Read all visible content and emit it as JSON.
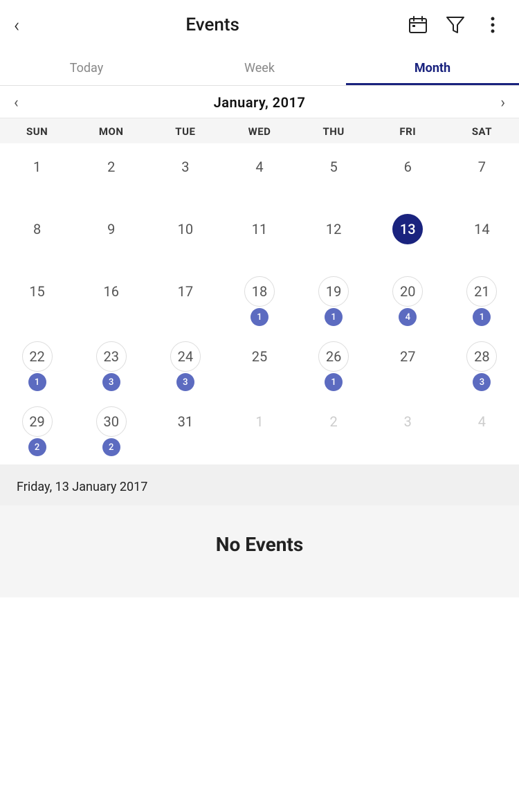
{
  "header": {
    "back_label": "‹",
    "title": "Events",
    "calendar_icon": "calendar-icon",
    "filter_icon": "filter-icon",
    "more_icon": "more-icon"
  },
  "tabs": [
    {
      "id": "today",
      "label": "Today",
      "active": false
    },
    {
      "id": "week",
      "label": "Week",
      "active": false
    },
    {
      "id": "month",
      "label": "Month",
      "active": true
    }
  ],
  "month_nav": {
    "title": "January, 2017",
    "prev_arrow": "‹",
    "next_arrow": "›"
  },
  "day_headers": [
    "SUN",
    "MON",
    "TUE",
    "WED",
    "THU",
    "FRI",
    "SAT"
  ],
  "weeks": [
    [
      {
        "day": 1,
        "otherMonth": false,
        "today": false,
        "hasRing": false,
        "events": 0
      },
      {
        "day": 2,
        "otherMonth": false,
        "today": false,
        "hasRing": false,
        "events": 0
      },
      {
        "day": 3,
        "otherMonth": false,
        "today": false,
        "hasRing": false,
        "events": 0
      },
      {
        "day": 4,
        "otherMonth": false,
        "today": false,
        "hasRing": false,
        "events": 0
      },
      {
        "day": 5,
        "otherMonth": false,
        "today": false,
        "hasRing": false,
        "events": 0
      },
      {
        "day": 6,
        "otherMonth": false,
        "today": false,
        "hasRing": false,
        "events": 0
      },
      {
        "day": 7,
        "otherMonth": false,
        "today": false,
        "hasRing": false,
        "events": 0
      }
    ],
    [
      {
        "day": 8,
        "otherMonth": false,
        "today": false,
        "hasRing": false,
        "events": 0
      },
      {
        "day": 9,
        "otherMonth": false,
        "today": false,
        "hasRing": false,
        "events": 0
      },
      {
        "day": 10,
        "otherMonth": false,
        "today": false,
        "hasRing": false,
        "events": 0
      },
      {
        "day": 11,
        "otherMonth": false,
        "today": false,
        "hasRing": false,
        "events": 0
      },
      {
        "day": 12,
        "otherMonth": false,
        "today": false,
        "hasRing": false,
        "events": 0
      },
      {
        "day": 13,
        "otherMonth": false,
        "today": true,
        "hasRing": false,
        "events": 0
      },
      {
        "day": 14,
        "otherMonth": false,
        "today": false,
        "hasRing": false,
        "events": 0
      }
    ],
    [
      {
        "day": 15,
        "otherMonth": false,
        "today": false,
        "hasRing": false,
        "events": 0
      },
      {
        "day": 16,
        "otherMonth": false,
        "today": false,
        "hasRing": false,
        "events": 0
      },
      {
        "day": 17,
        "otherMonth": false,
        "today": false,
        "hasRing": false,
        "events": 0
      },
      {
        "day": 18,
        "otherMonth": false,
        "today": false,
        "hasRing": true,
        "events": 1
      },
      {
        "day": 19,
        "otherMonth": false,
        "today": false,
        "hasRing": true,
        "events": 1
      },
      {
        "day": 20,
        "otherMonth": false,
        "today": false,
        "hasRing": true,
        "events": 4
      },
      {
        "day": 21,
        "otherMonth": false,
        "today": false,
        "hasRing": true,
        "events": 1
      }
    ],
    [
      {
        "day": 22,
        "otherMonth": false,
        "today": false,
        "hasRing": true,
        "events": 1
      },
      {
        "day": 23,
        "otherMonth": false,
        "today": false,
        "hasRing": true,
        "events": 3
      },
      {
        "day": 24,
        "otherMonth": false,
        "today": false,
        "hasRing": true,
        "events": 3
      },
      {
        "day": 25,
        "otherMonth": false,
        "today": false,
        "hasRing": false,
        "events": 0
      },
      {
        "day": 26,
        "otherMonth": false,
        "today": false,
        "hasRing": true,
        "events": 1
      },
      {
        "day": 27,
        "otherMonth": false,
        "today": false,
        "hasRing": false,
        "events": 0
      },
      {
        "day": 28,
        "otherMonth": false,
        "today": false,
        "hasRing": true,
        "events": 3
      }
    ],
    [
      {
        "day": 29,
        "otherMonth": false,
        "today": false,
        "hasRing": true,
        "events": 2
      },
      {
        "day": 30,
        "otherMonth": false,
        "today": false,
        "hasRing": true,
        "events": 2
      },
      {
        "day": 31,
        "otherMonth": false,
        "today": false,
        "hasRing": false,
        "events": 0
      },
      {
        "day": 1,
        "otherMonth": true,
        "today": false,
        "hasRing": false,
        "events": 0
      },
      {
        "day": 2,
        "otherMonth": true,
        "today": false,
        "hasRing": false,
        "events": 0
      },
      {
        "day": 3,
        "otherMonth": true,
        "today": false,
        "hasRing": false,
        "events": 0
      },
      {
        "day": 4,
        "otherMonth": true,
        "today": false,
        "hasRing": false,
        "events": 0
      }
    ]
  ],
  "selected_date": "Friday, 13 January 2017",
  "no_events_label": "No Events",
  "colors": {
    "accent": "#1a237e",
    "badge": "#5c6bc0",
    "ring": "#ddd"
  }
}
